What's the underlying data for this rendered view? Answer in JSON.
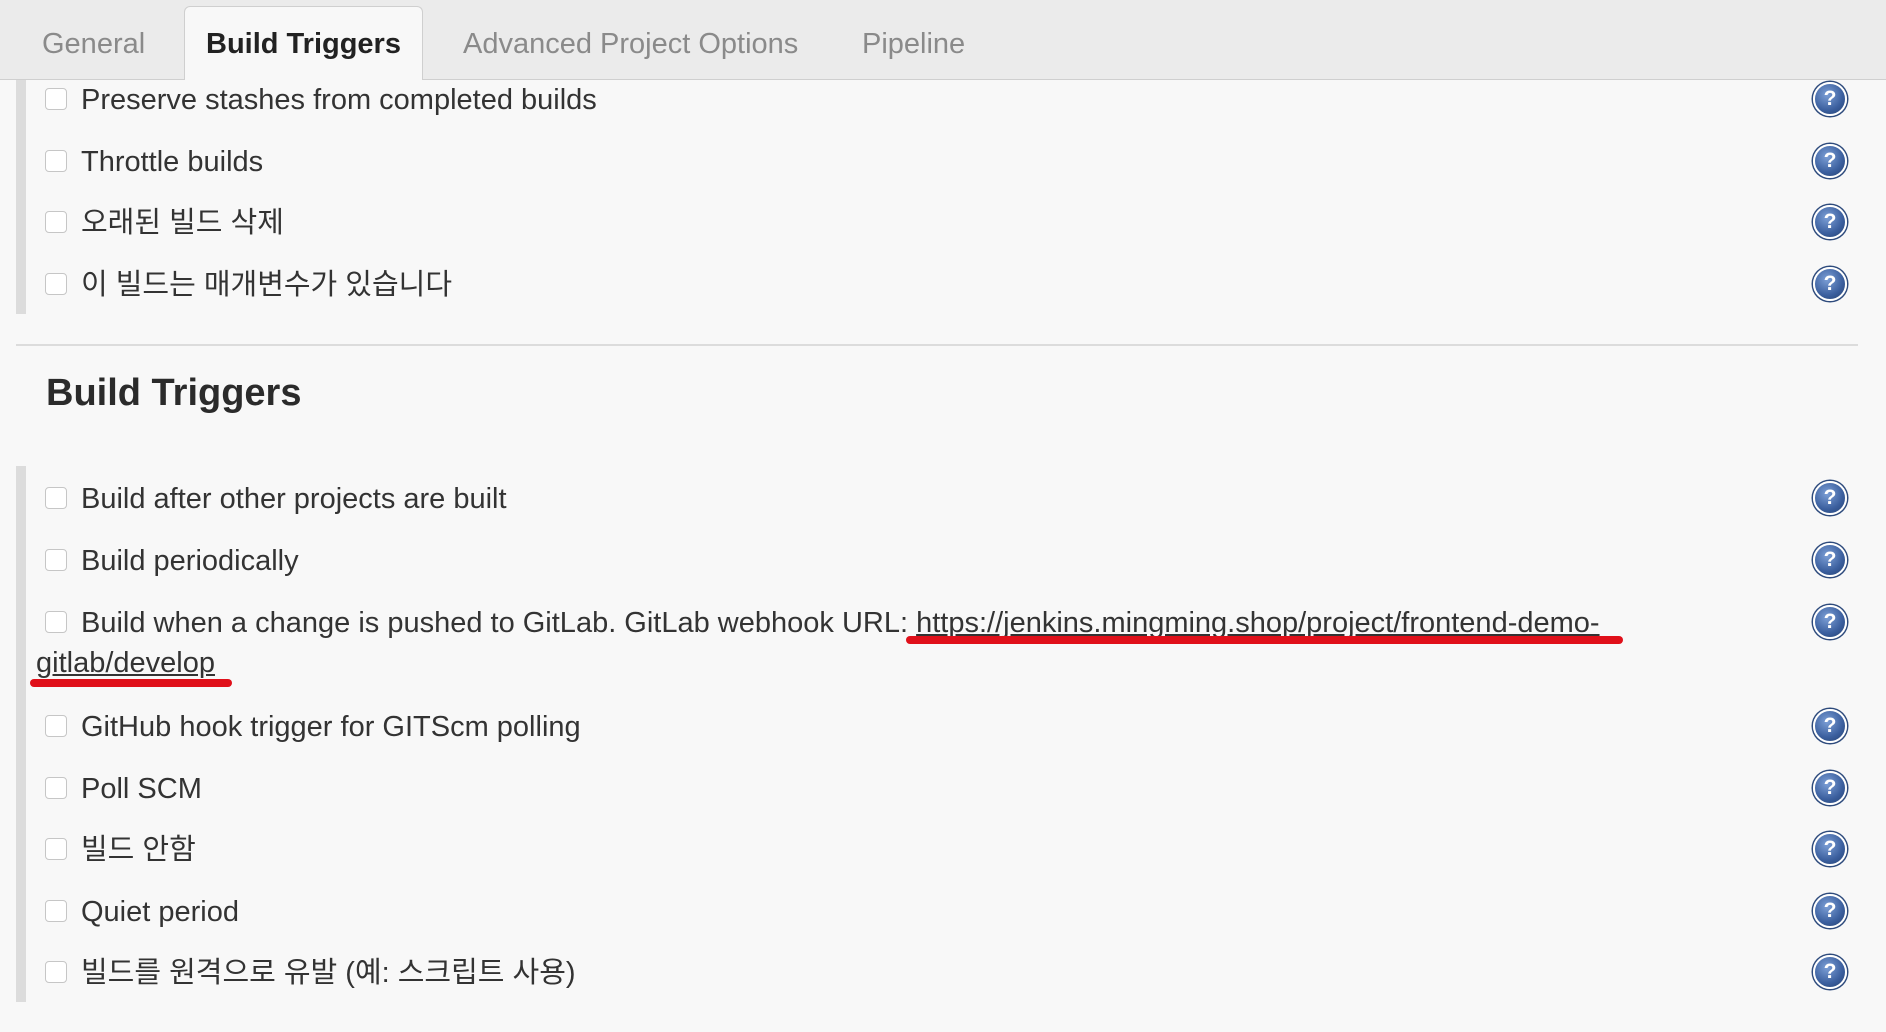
{
  "tabs": [
    {
      "label": "General",
      "active": false
    },
    {
      "label": "Build Triggers",
      "active": true
    },
    {
      "label": "Advanced Project Options",
      "active": false
    },
    {
      "label": "Pipeline",
      "active": false
    }
  ],
  "general_options": [
    {
      "label": "Preserve stashes from completed builds",
      "checked": false
    },
    {
      "label": "Throttle builds",
      "checked": false
    },
    {
      "label": "오래된 빌드 삭제",
      "checked": false
    },
    {
      "label": "이 빌드는 매개변수가 있습니다",
      "checked": false
    }
  ],
  "build_triggers": {
    "title": "Build Triggers",
    "gitlab": {
      "label_prefix": "Build when a change is pushed to GitLab. GitLab webhook URL: ",
      "url_part1": "https://jenkins.mingming.shop/project/frontend-demo-",
      "url_part2": "gitlab/develop",
      "checked": false
    },
    "options": [
      {
        "label": "Build after other projects are built",
        "checked": false
      },
      {
        "label": "Build periodically",
        "checked": false
      },
      {
        "label": "GitHub hook trigger for GITScm polling",
        "checked": false
      },
      {
        "label": "Poll SCM",
        "checked": false
      },
      {
        "label": "빌드 안함",
        "checked": false
      },
      {
        "label": "Quiet period",
        "checked": false
      },
      {
        "label": "빌드를 원격으로 유발 (예: 스크립트 사용)",
        "checked": false
      }
    ]
  },
  "help_icon": {
    "glyph": "?",
    "color": "#3b5f9e"
  },
  "annotation_color": "#e0101a"
}
